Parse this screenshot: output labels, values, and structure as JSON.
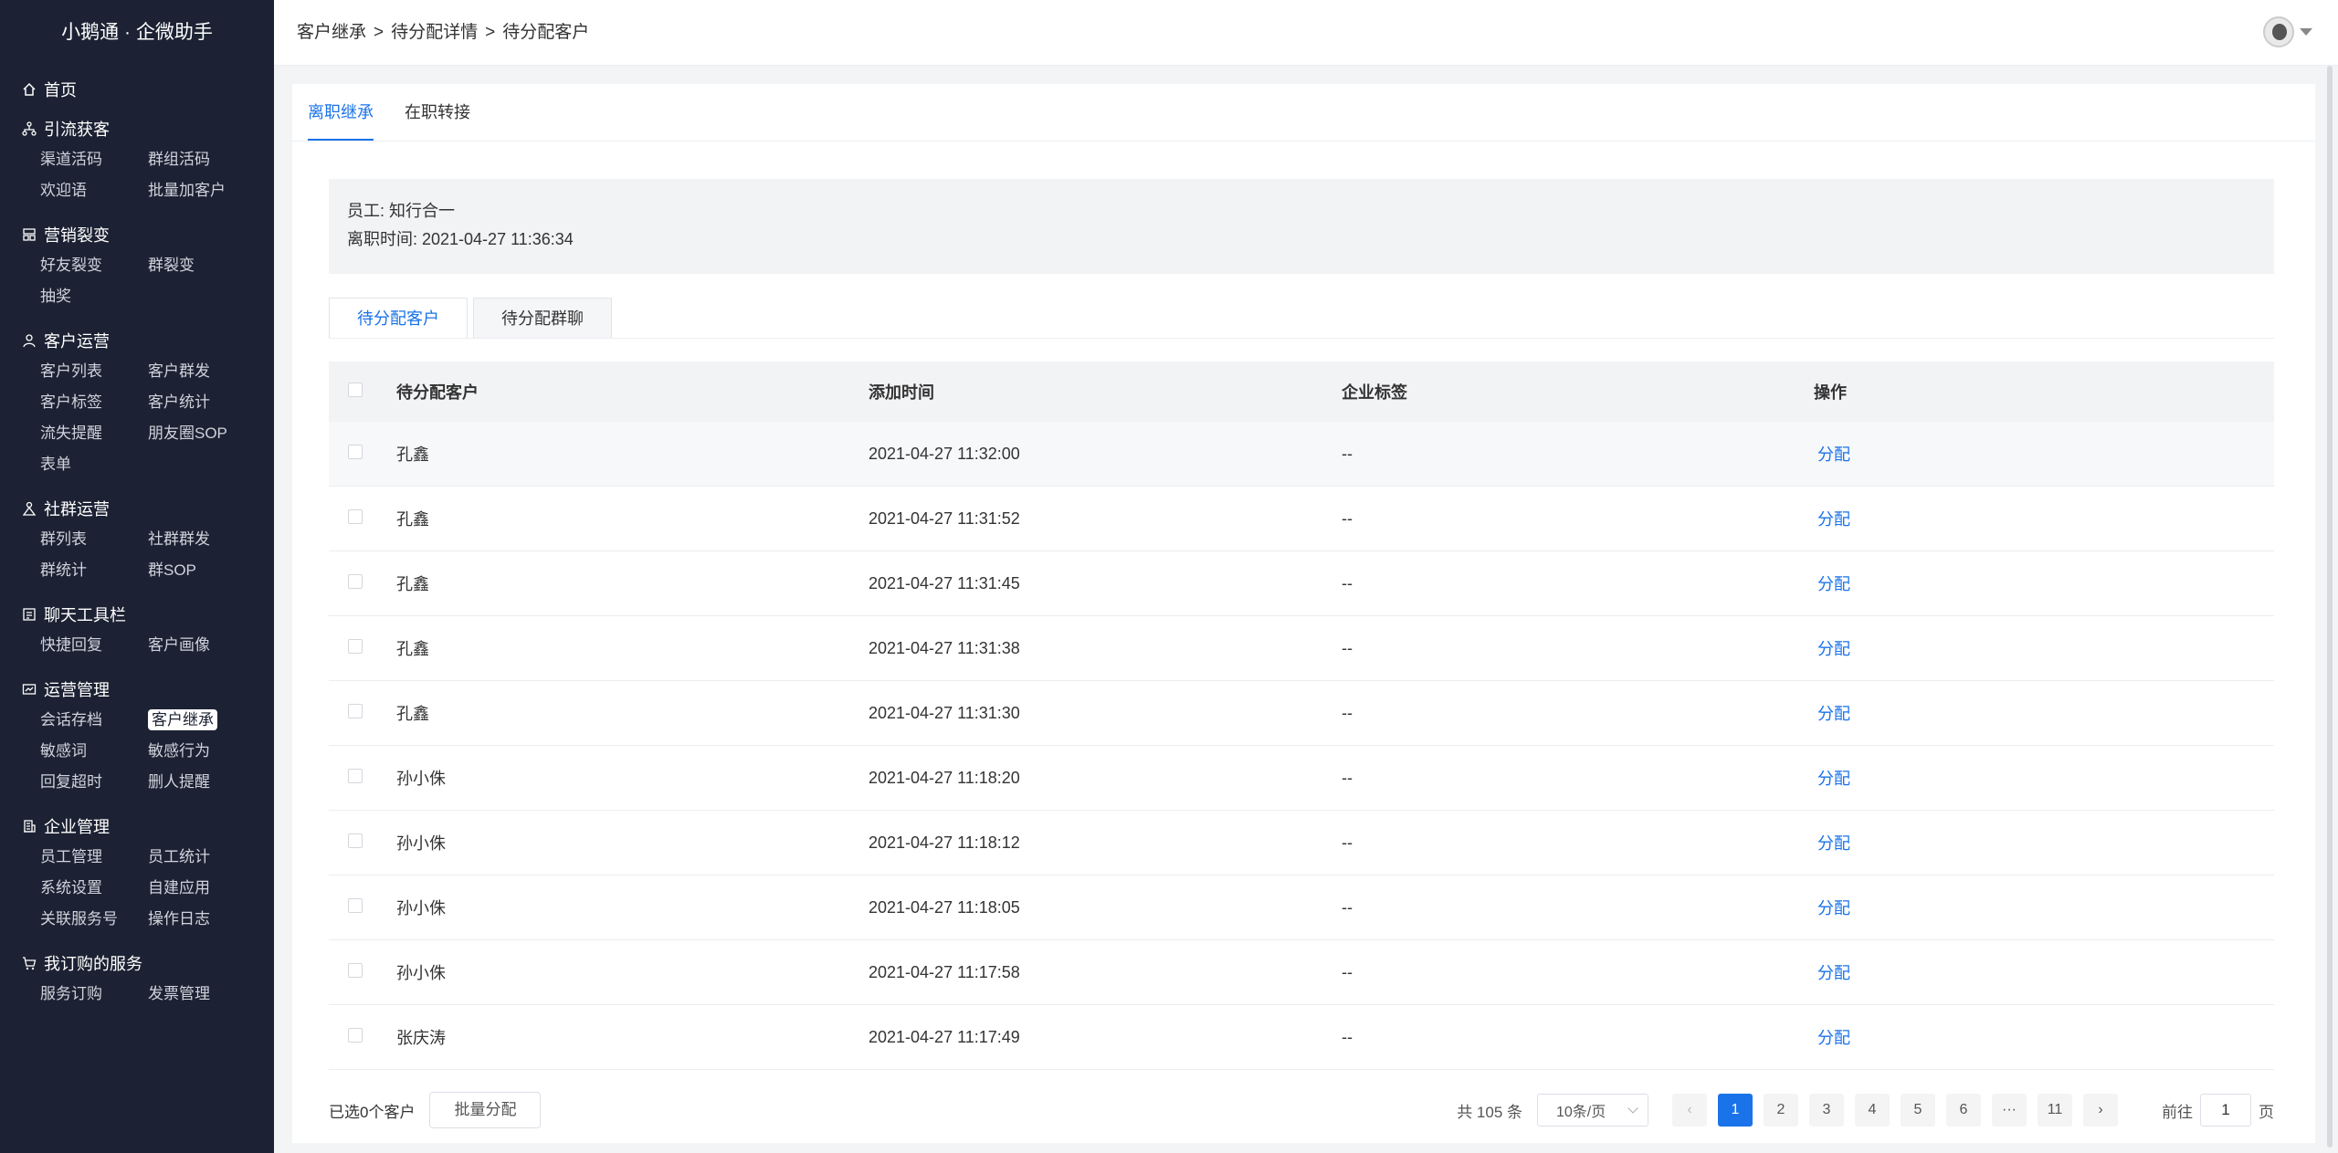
{
  "app": {
    "brand": "小鹅通 · 企微助手"
  },
  "sidebar": {
    "home": {
      "label": "首页",
      "icon": "home-icon"
    },
    "groups": [
      {
        "title": "引流获客",
        "icon": "network-icon",
        "items": [
          "渠道活码",
          "群组活码",
          "欢迎语",
          "批量加客户"
        ]
      },
      {
        "title": "营销裂变",
        "icon": "split-icon",
        "items": [
          "好友裂变",
          "群裂变",
          "抽奖"
        ]
      },
      {
        "title": "客户运营",
        "icon": "user-icon",
        "items": [
          "客户列表",
          "客户群发",
          "客户标签",
          "客户统计",
          "流失提醒",
          "朋友圈SOP",
          "表单"
        ]
      },
      {
        "title": "社群运营",
        "icon": "community-icon",
        "items": [
          "群列表",
          "社群群发",
          "群统计",
          "群SOP"
        ]
      },
      {
        "title": "聊天工具栏",
        "icon": "chat-tool-icon",
        "items": [
          "快捷回复",
          "客户画像"
        ]
      },
      {
        "title": "运营管理",
        "icon": "ops-icon",
        "items": [
          "会话存档",
          "客户继承",
          "敏感词",
          "敏感行为",
          "回复超时",
          "删人提醒"
        ]
      },
      {
        "title": "企业管理",
        "icon": "building-icon",
        "items": [
          "员工管理",
          "员工统计",
          "系统设置",
          "自建应用",
          "关联服务号",
          "操作日志"
        ]
      },
      {
        "title": "我订购的服务",
        "icon": "cart-icon",
        "items": [
          "服务订购",
          "发票管理"
        ]
      }
    ],
    "active_item": "客户继承"
  },
  "header": {
    "breadcrumb": [
      "客户继承",
      "待分配详情",
      "待分配客户"
    ],
    "breadcrumb_sep": ">"
  },
  "tabs": {
    "items": [
      "离职继承",
      "在职转接"
    ],
    "active": 0
  },
  "info": {
    "employee_label": "员工: 知行合一",
    "leave_time_label": "离职时间: 2021-04-27 11:36:34"
  },
  "sub_tabs": {
    "items": [
      "待分配客户",
      "待分配群聊"
    ],
    "active": 0
  },
  "table": {
    "columns": [
      "待分配客户",
      "添加时间",
      "企业标签",
      "操作"
    ],
    "rows": [
      {
        "name": "孔鑫",
        "time": "2021-04-27 11:32:00",
        "tag": "--",
        "op": "分配"
      },
      {
        "name": "孔鑫",
        "time": "2021-04-27 11:31:52",
        "tag": "--",
        "op": "分配"
      },
      {
        "name": "孔鑫",
        "time": "2021-04-27 11:31:45",
        "tag": "--",
        "op": "分配"
      },
      {
        "name": "孔鑫",
        "time": "2021-04-27 11:31:38",
        "tag": "--",
        "op": "分配"
      },
      {
        "name": "孔鑫",
        "time": "2021-04-27 11:31:30",
        "tag": "--",
        "op": "分配"
      },
      {
        "name": "孙小侏",
        "time": "2021-04-27 11:18:20",
        "tag": "--",
        "op": "分配"
      },
      {
        "name": "孙小侏",
        "time": "2021-04-27 11:18:12",
        "tag": "--",
        "op": "分配"
      },
      {
        "name": "孙小侏",
        "time": "2021-04-27 11:18:05",
        "tag": "--",
        "op": "分配"
      },
      {
        "name": "孙小侏",
        "time": "2021-04-27 11:17:58",
        "tag": "--",
        "op": "分配"
      },
      {
        "name": "张庆涛",
        "time": "2021-04-27 11:17:49",
        "tag": "--",
        "op": "分配"
      }
    ]
  },
  "footer": {
    "selected": "已选0个客户",
    "batch_button": "批量分配"
  },
  "pagination": {
    "total": "共 105 条",
    "page_size": "10条/页",
    "prev": "‹",
    "next": "›",
    "pages": [
      "1",
      "2",
      "3",
      "4",
      "5",
      "6",
      "···",
      "11"
    ],
    "current": "1",
    "goto_prefix": "前往",
    "goto_value": "1",
    "goto_suffix": "页"
  },
  "colors": {
    "sidebar_bg": "#1c2233",
    "accent": "#1a73e8",
    "page_bg": "#f3f4f6"
  }
}
